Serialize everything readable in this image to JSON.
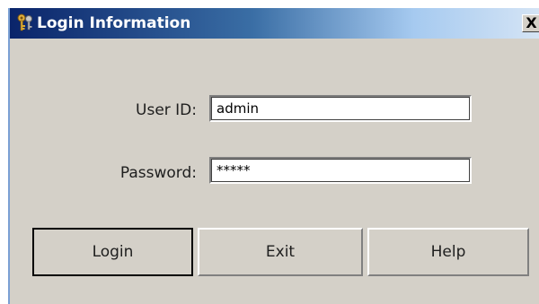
{
  "window": {
    "title": "Login Information",
    "close_label": "X",
    "title_icon": "keys-icon"
  },
  "form": {
    "userid_label": "User ID:",
    "userid_value": "admin",
    "password_label": "Password:",
    "password_value": "*****"
  },
  "buttons": {
    "login_label": "Login",
    "exit_label": "Exit",
    "help_label": "Help"
  },
  "colors": {
    "titlebar_start": "#0a246a",
    "titlebar_end": "#d8e6f5",
    "face": "#d4d0c8"
  }
}
